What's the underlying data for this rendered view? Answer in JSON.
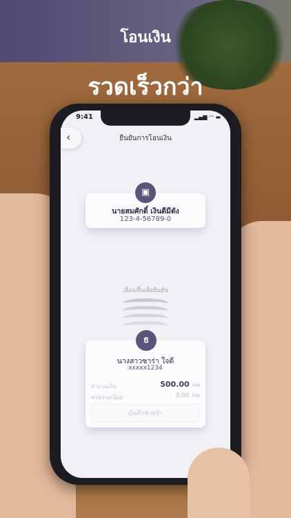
{
  "promo": {
    "title": "โอนเงิน",
    "headline": "รวดเร็วกว่า"
  },
  "status": {
    "time": "9:41",
    "icons": "signal wifi battery"
  },
  "nav": {
    "title": "ยืนยันการโอนเงิน",
    "back_icon": "chevron-left"
  },
  "recipient": {
    "name": "นายสมศักดิ์ เงินดีมีตัง",
    "account": "123-4-56789-0",
    "icon": "phone-card"
  },
  "swipe_hint": "เลื่อนขึ้นเพื่อยืนยัน",
  "sender": {
    "name": "นางสาวซาร่า ใจดี",
    "account": "xxxxx1234",
    "icon": "bank"
  },
  "amount": {
    "label": "จำนวนเงิน",
    "value": "500.00",
    "currency": "THB"
  },
  "fee": {
    "label": "ค่าธรรมเนียม",
    "value": "0.00",
    "currency": "THB"
  },
  "memo_button": "บันทึกช่วยจำ",
  "colors": {
    "accent": "#5b5378"
  }
}
